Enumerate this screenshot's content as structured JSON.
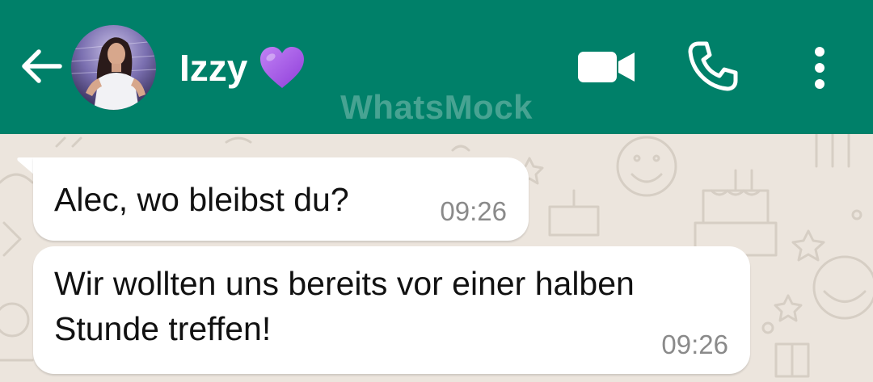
{
  "header": {
    "contact_name": "Izzy",
    "contact_emoji": "purple-heart",
    "watermark": "WhatsMock",
    "background_color": "#008069",
    "icons": [
      "back-arrow-icon",
      "video-call-icon",
      "phone-call-icon",
      "more-options-icon"
    ]
  },
  "messages": [
    {
      "text": "Alec, wo bleibst du?",
      "time": "09:26",
      "direction": "incoming"
    },
    {
      "text": "Wir wollten uns bereits vor einer halben\nStunde treffen!",
      "time": "09:26",
      "direction": "incoming"
    }
  ],
  "colors": {
    "chat_background": "#ece5dd",
    "bubble": "#ffffff",
    "heart": "#a259e6"
  }
}
